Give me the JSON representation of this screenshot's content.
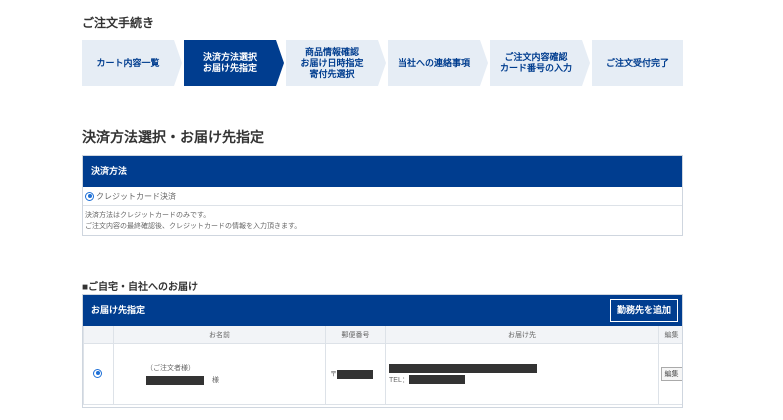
{
  "page": {
    "heading": "ご注文手続き"
  },
  "steps": [
    {
      "label": "カート内容一覧",
      "active": false
    },
    {
      "label": "決済方法選択\nお届け先指定",
      "active": true
    },
    {
      "label": "商品情報確認\nお届け日時指定\n寄付先選択",
      "active": false
    },
    {
      "label": "当社への連絡事項",
      "active": false
    },
    {
      "label": "ご注文内容確認\nカード番号の入力",
      "active": false
    },
    {
      "label": "ご注文受付完了",
      "active": false
    }
  ],
  "section": {
    "title": "決済方法選択・お届け先指定"
  },
  "payment": {
    "header": "決済方法",
    "option_label": "クレジットカード決済",
    "note_line1": "決済方法はクレジットカードのみです。",
    "note_line2": "ご注文内容の最終確認後、クレジットカードの情報を入力頂きます。"
  },
  "delivery": {
    "section_title": "■ご自宅・自社へのお届け",
    "header": "お届け先指定",
    "add_button": "勤務先を追加",
    "columns": {
      "name": "お名前",
      "postal": "郵便番号",
      "address": "お届け先",
      "edit": "編集"
    },
    "row": {
      "name_note": "（ご注文者様）",
      "honorific": "様",
      "postal_prefix": "〒",
      "tel_prefix": "TEL：",
      "edit_button": "編集"
    }
  },
  "colors": {
    "primary": "#003d8f",
    "step_bg": "#e6edf5",
    "radio": "#1d6fd6"
  }
}
